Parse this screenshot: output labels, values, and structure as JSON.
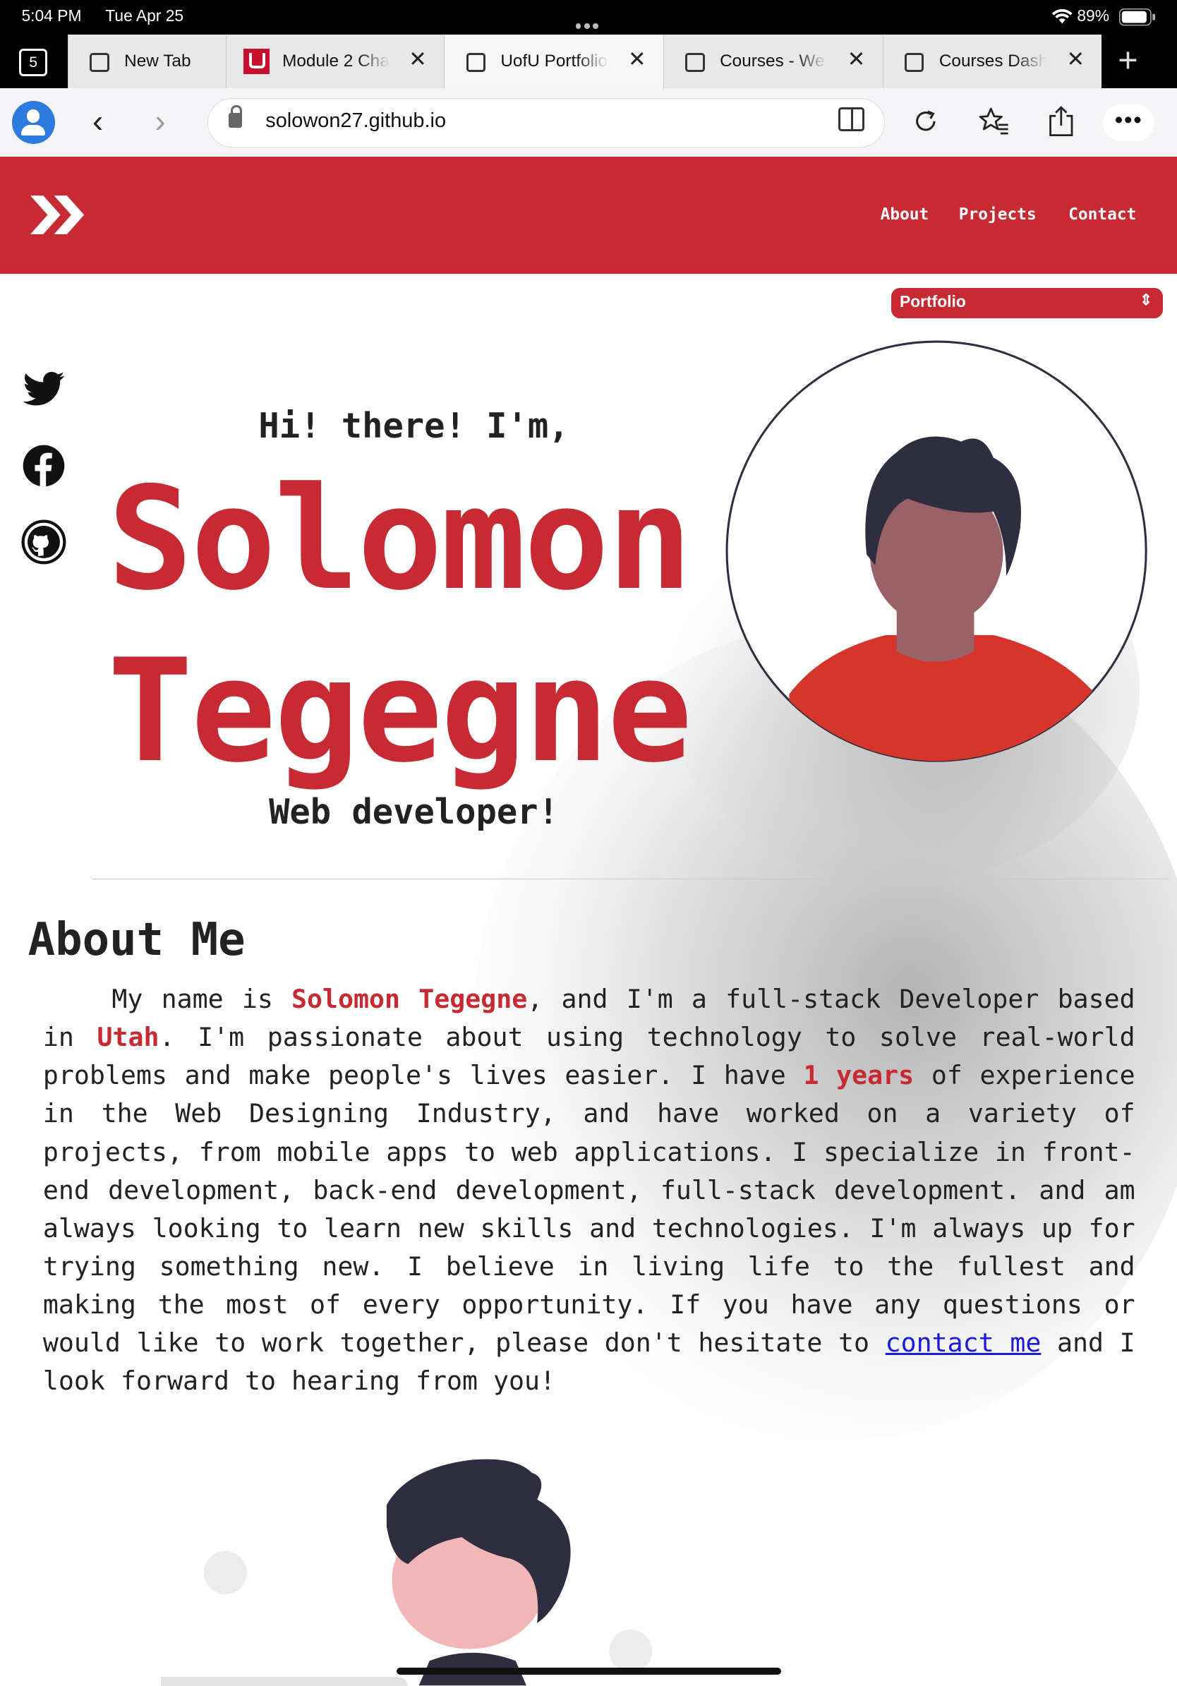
{
  "status_bar": {
    "time": "5:04 PM",
    "date": "Tue Apr 25",
    "battery": "89%"
  },
  "tabs": {
    "count": "5",
    "items": [
      {
        "label": "New Tab",
        "icon": "page-icon",
        "active": false
      },
      {
        "label": "Module 2 Cha",
        "icon": "uofu-logo",
        "active": false
      },
      {
        "label": "UofU Portfolio",
        "icon": "page-icon",
        "active": true
      },
      {
        "label": "Courses - We",
        "icon": "page-icon",
        "active": false
      },
      {
        "label": "Courses Dash",
        "icon": "page-icon",
        "active": false
      }
    ]
  },
  "address_bar": {
    "url": "solowon27.github.io"
  },
  "site": {
    "nav": {
      "about": "About",
      "projects": "Projects",
      "contact": "Contact"
    },
    "select_value": "Portfolio",
    "brand_color": "#c72a33",
    "social": [
      "twitter-icon",
      "facebook-icon",
      "github-icon"
    ]
  },
  "hero": {
    "greeting": "Hi! there! I'm,",
    "first_name": "Solomon",
    "last_name": "Tegegne",
    "role": "Web developer!"
  },
  "about": {
    "heading": "About Me",
    "p1": "My name is ",
    "name": "Solomon Tegegne",
    "p2": ", and I'm a full-stack Developer based in ",
    "location": "Utah",
    "p3": ". I'm passionate about using technology to solve real-world problems and make people's lives easier. I have ",
    "years": "1 years",
    "p4": " of experience in the Web Designing Industry, and have worked on a variety of projects, from mobile apps to web applications. I specialize in front-end development, back-end development, full-stack development. and am always looking to learn new skills and technologies. I'm always up for trying something new. I believe in living life to the fullest and making the most of every opportunity. If you have any questions or would like to work together, please don't hesitate to ",
    "link": "contact me",
    "p5": " and I look forward to hearing from you!"
  }
}
